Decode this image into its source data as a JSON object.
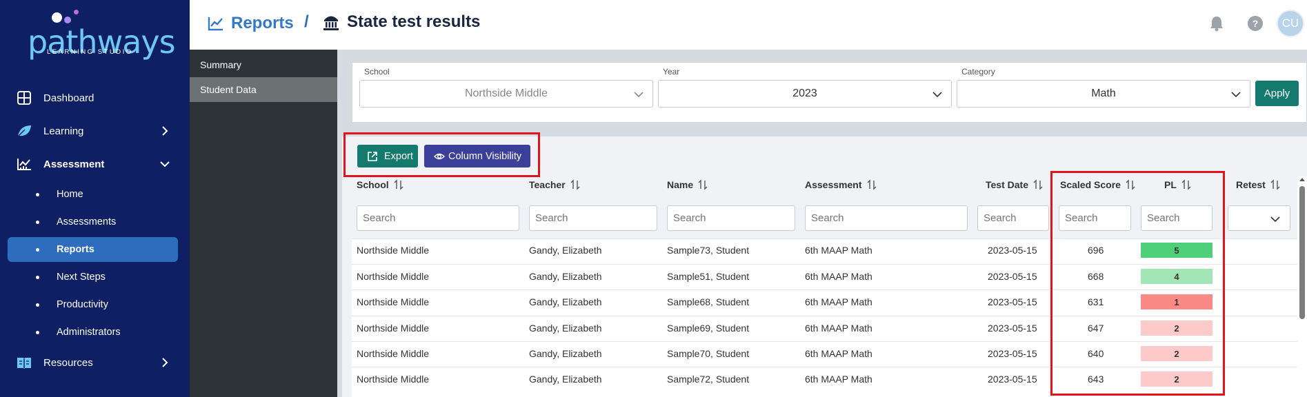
{
  "brand": {
    "name": "pathways",
    "tagline": "LEARNING STUDIO"
  },
  "sidebar": {
    "items": [
      {
        "label": "Dashboard",
        "icon": "dashboard-icon"
      },
      {
        "label": "Learning",
        "icon": "leaf-icon"
      },
      {
        "label": "Assessment",
        "icon": "chart-icon"
      },
      {
        "label": "Resources",
        "icon": "book-icon"
      }
    ],
    "assessment_children": [
      "Home",
      "Assessments",
      "Reports",
      "Next Steps",
      "Productivity",
      "Administrators"
    ],
    "active_child": "Reports"
  },
  "header": {
    "breadcrumb_root": "Reports",
    "separator": "/",
    "page_title": "State test results",
    "avatar_initials": "CU"
  },
  "subnav": {
    "items": [
      "Summary",
      "Student Data"
    ],
    "active": "Student Data"
  },
  "filters": {
    "school": {
      "label": "School",
      "value": "Northside Middle"
    },
    "year": {
      "label": "Year",
      "value": "2023"
    },
    "category": {
      "label": "Category",
      "value": "Math"
    },
    "apply_label": "Apply"
  },
  "toolbar": {
    "export_label": "Export",
    "column_visibility_label": "Column Visibility"
  },
  "table": {
    "columns": [
      "School",
      "Teacher",
      "Name",
      "Assessment",
      "Test Date",
      "Scaled Score",
      "PL",
      "Retest"
    ],
    "search_placeholder": "Search",
    "rows": [
      {
        "school": "Northside Middle",
        "teacher": "Gandy, Elizabeth",
        "name": "Sample73, Student",
        "assessment": "6th MAAP Math",
        "test_date": "2023-05-15",
        "scaled_score": "696",
        "pl": "5"
      },
      {
        "school": "Northside Middle",
        "teacher": "Gandy, Elizabeth",
        "name": "Sample51, Student",
        "assessment": "6th MAAP Math",
        "test_date": "2023-05-15",
        "scaled_score": "668",
        "pl": "4"
      },
      {
        "school": "Northside Middle",
        "teacher": "Gandy, Elizabeth",
        "name": "Sample68, Student",
        "assessment": "6th MAAP Math",
        "test_date": "2023-05-15",
        "scaled_score": "631",
        "pl": "1"
      },
      {
        "school": "Northside Middle",
        "teacher": "Gandy, Elizabeth",
        "name": "Sample69, Student",
        "assessment": "6th MAAP Math",
        "test_date": "2023-05-15",
        "scaled_score": "647",
        "pl": "2"
      },
      {
        "school": "Northside Middle",
        "teacher": "Gandy, Elizabeth",
        "name": "Sample70, Student",
        "assessment": "6th MAAP Math",
        "test_date": "2023-05-15",
        "scaled_score": "640",
        "pl": "2"
      },
      {
        "school": "Northside Middle",
        "teacher": "Gandy, Elizabeth",
        "name": "Sample72, Student",
        "assessment": "6th MAAP Math",
        "test_date": "2023-05-15",
        "scaled_score": "643",
        "pl": "2"
      }
    ]
  },
  "colors": {
    "sidebar_bg": "#0e1f63",
    "active_nav": "#2e6dbd",
    "primary_teal": "#157a6e",
    "indigo": "#3a3f9a",
    "highlight_red": "#e1141c",
    "pl_5": "#4fcf7a",
    "pl_4": "#a3e6b6",
    "pl_1": "#f98a86",
    "pl_2": "#fecaca"
  }
}
